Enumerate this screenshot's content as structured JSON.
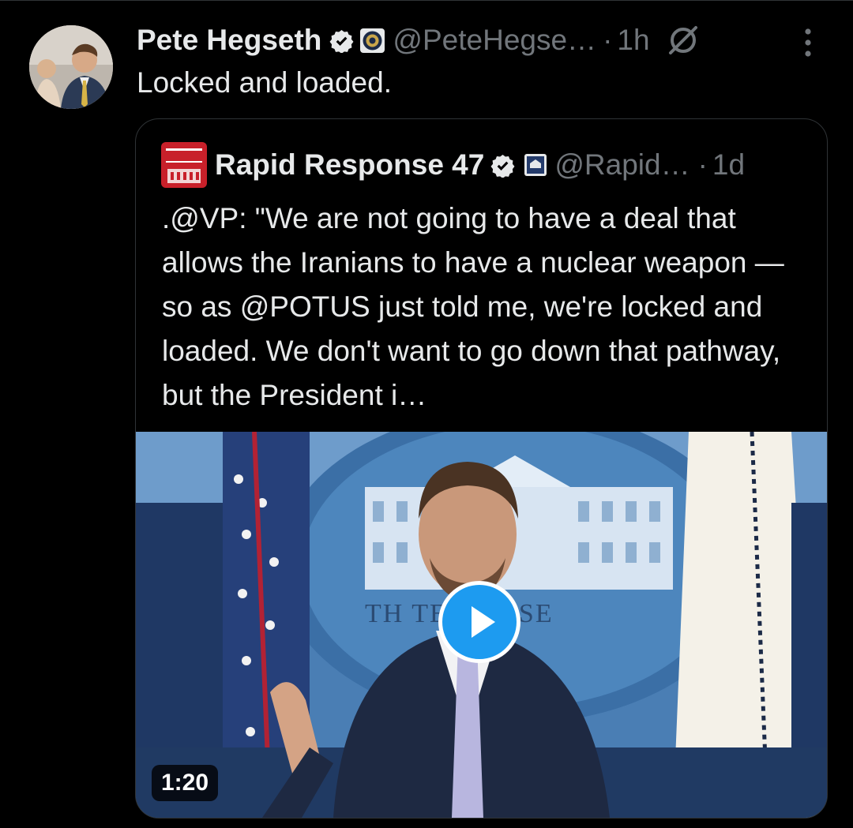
{
  "post": {
    "author_name": "Pete Hegseth",
    "handle": "@PeteHegse…",
    "dot": "·",
    "time": "1h",
    "text": "Locked and loaded."
  },
  "quoted": {
    "author_name": "Rapid Response 47",
    "handle": "@Rapid…",
    "dot": "·",
    "time": "1d",
    "text": ".@VP: \"We are not going to have a deal that allows the Iranians to have a nuclear weapon — so as @POTUS just told me, we're locked and loaded. We don't want to go down that pathway, but the President i…",
    "video_duration": "1:20",
    "video_scene_text": "TH  TE HOUSE"
  },
  "icons": {
    "verified": "verified-badge-icon",
    "affiliation_pete": "dod-seal-icon",
    "affiliation_rapid": "white-house-icon",
    "grok": "grok-icon",
    "more": "more-options-icon",
    "play": "play-icon"
  },
  "colors": {
    "background": "#000000",
    "text_primary": "#e7e9ea",
    "text_secondary": "#71767b",
    "accent": "#1d9bf0"
  }
}
